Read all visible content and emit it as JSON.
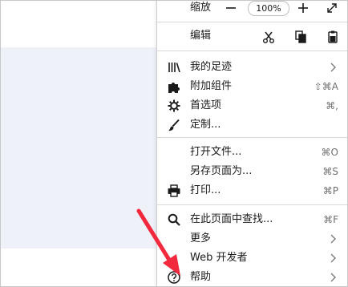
{
  "zoom": {
    "label": "缩放",
    "value": "100%"
  },
  "edit": {
    "label": "编辑"
  },
  "menu": {
    "library": {
      "label": "我的足迹"
    },
    "addons": {
      "label": "附加组件",
      "shortcut": "⇧⌘A"
    },
    "preferences": {
      "label": "首选项",
      "shortcut": "⌘,"
    },
    "customize": {
      "label": "定制..."
    },
    "open_file": {
      "label": "打开文件...",
      "shortcut": "⌘O"
    },
    "save_page": {
      "label": "另存页面为...",
      "shortcut": "⌘S"
    },
    "print": {
      "label": "打印...",
      "shortcut": "⌘P"
    },
    "find": {
      "label": "在此页面中查找...",
      "shortcut": "⌘F"
    },
    "more": {
      "label": "更多"
    },
    "web_developer": {
      "label": "Web 开发者"
    },
    "help": {
      "label": "帮助"
    }
  },
  "colors": {
    "page_background": "#eef1f8",
    "annotation_arrow": "#f2283c"
  }
}
